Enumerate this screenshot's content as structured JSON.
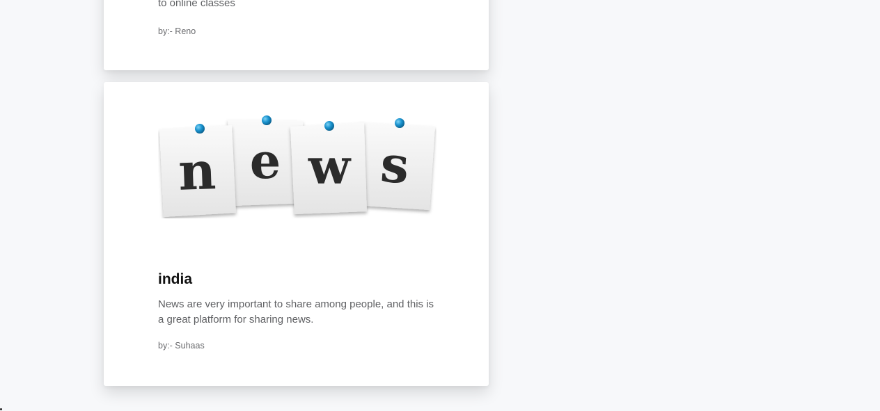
{
  "posts": [
    {
      "description_tail": "to online classes",
      "author": "by:- Reno"
    },
    {
      "image_icon": "news-pinned-notes-image",
      "image_letters": [
        "n",
        "e",
        "w",
        "s"
      ],
      "title": "india",
      "description": "News are very important to share among people, and this is a great platform for sharing news.",
      "author": "by:- Suhaas"
    }
  ]
}
